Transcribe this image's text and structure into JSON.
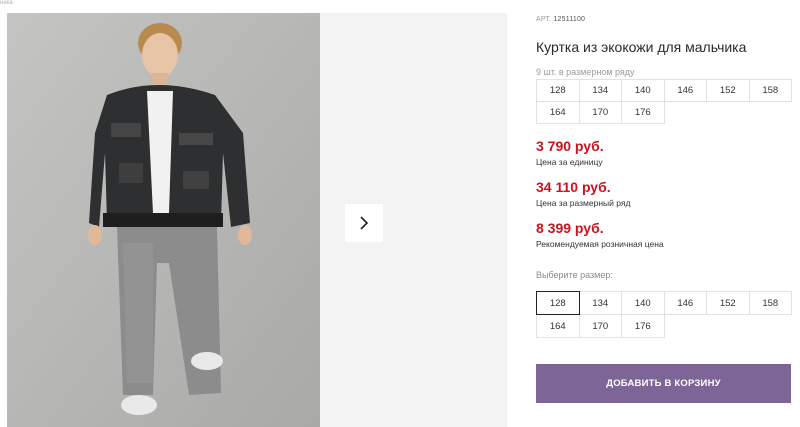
{
  "product": {
    "sku_label": "АРТ.",
    "sku": "12511100",
    "title": "Куртка из экокожи для мальчика",
    "pack_note": "9 шт. в размерном ряду",
    "pack_sizes": [
      "128",
      "134",
      "140",
      "146",
      "152",
      "158",
      "164",
      "170",
      "176"
    ]
  },
  "prices": {
    "unit_price": "3 790 руб.",
    "unit_label": "Цена за единицу",
    "row_price": "34 110 руб.",
    "row_label": "Цена за размерный ряд",
    "retail_price": "8 399 руб.",
    "retail_label": "Рекомендуемая розничная цена"
  },
  "size_select": {
    "label": "Выберите размер:",
    "selected": "128",
    "options": [
      "128",
      "134",
      "140",
      "146",
      "152",
      "158",
      "164",
      "170",
      "176"
    ]
  },
  "cart_button": "ДОБАВИТЬ В КОРЗИНУ",
  "colors": {
    "price_red": "#d0111d",
    "button_purple": "#7d6598"
  },
  "icons": {
    "gallery_next": "chevron-right-icon"
  }
}
